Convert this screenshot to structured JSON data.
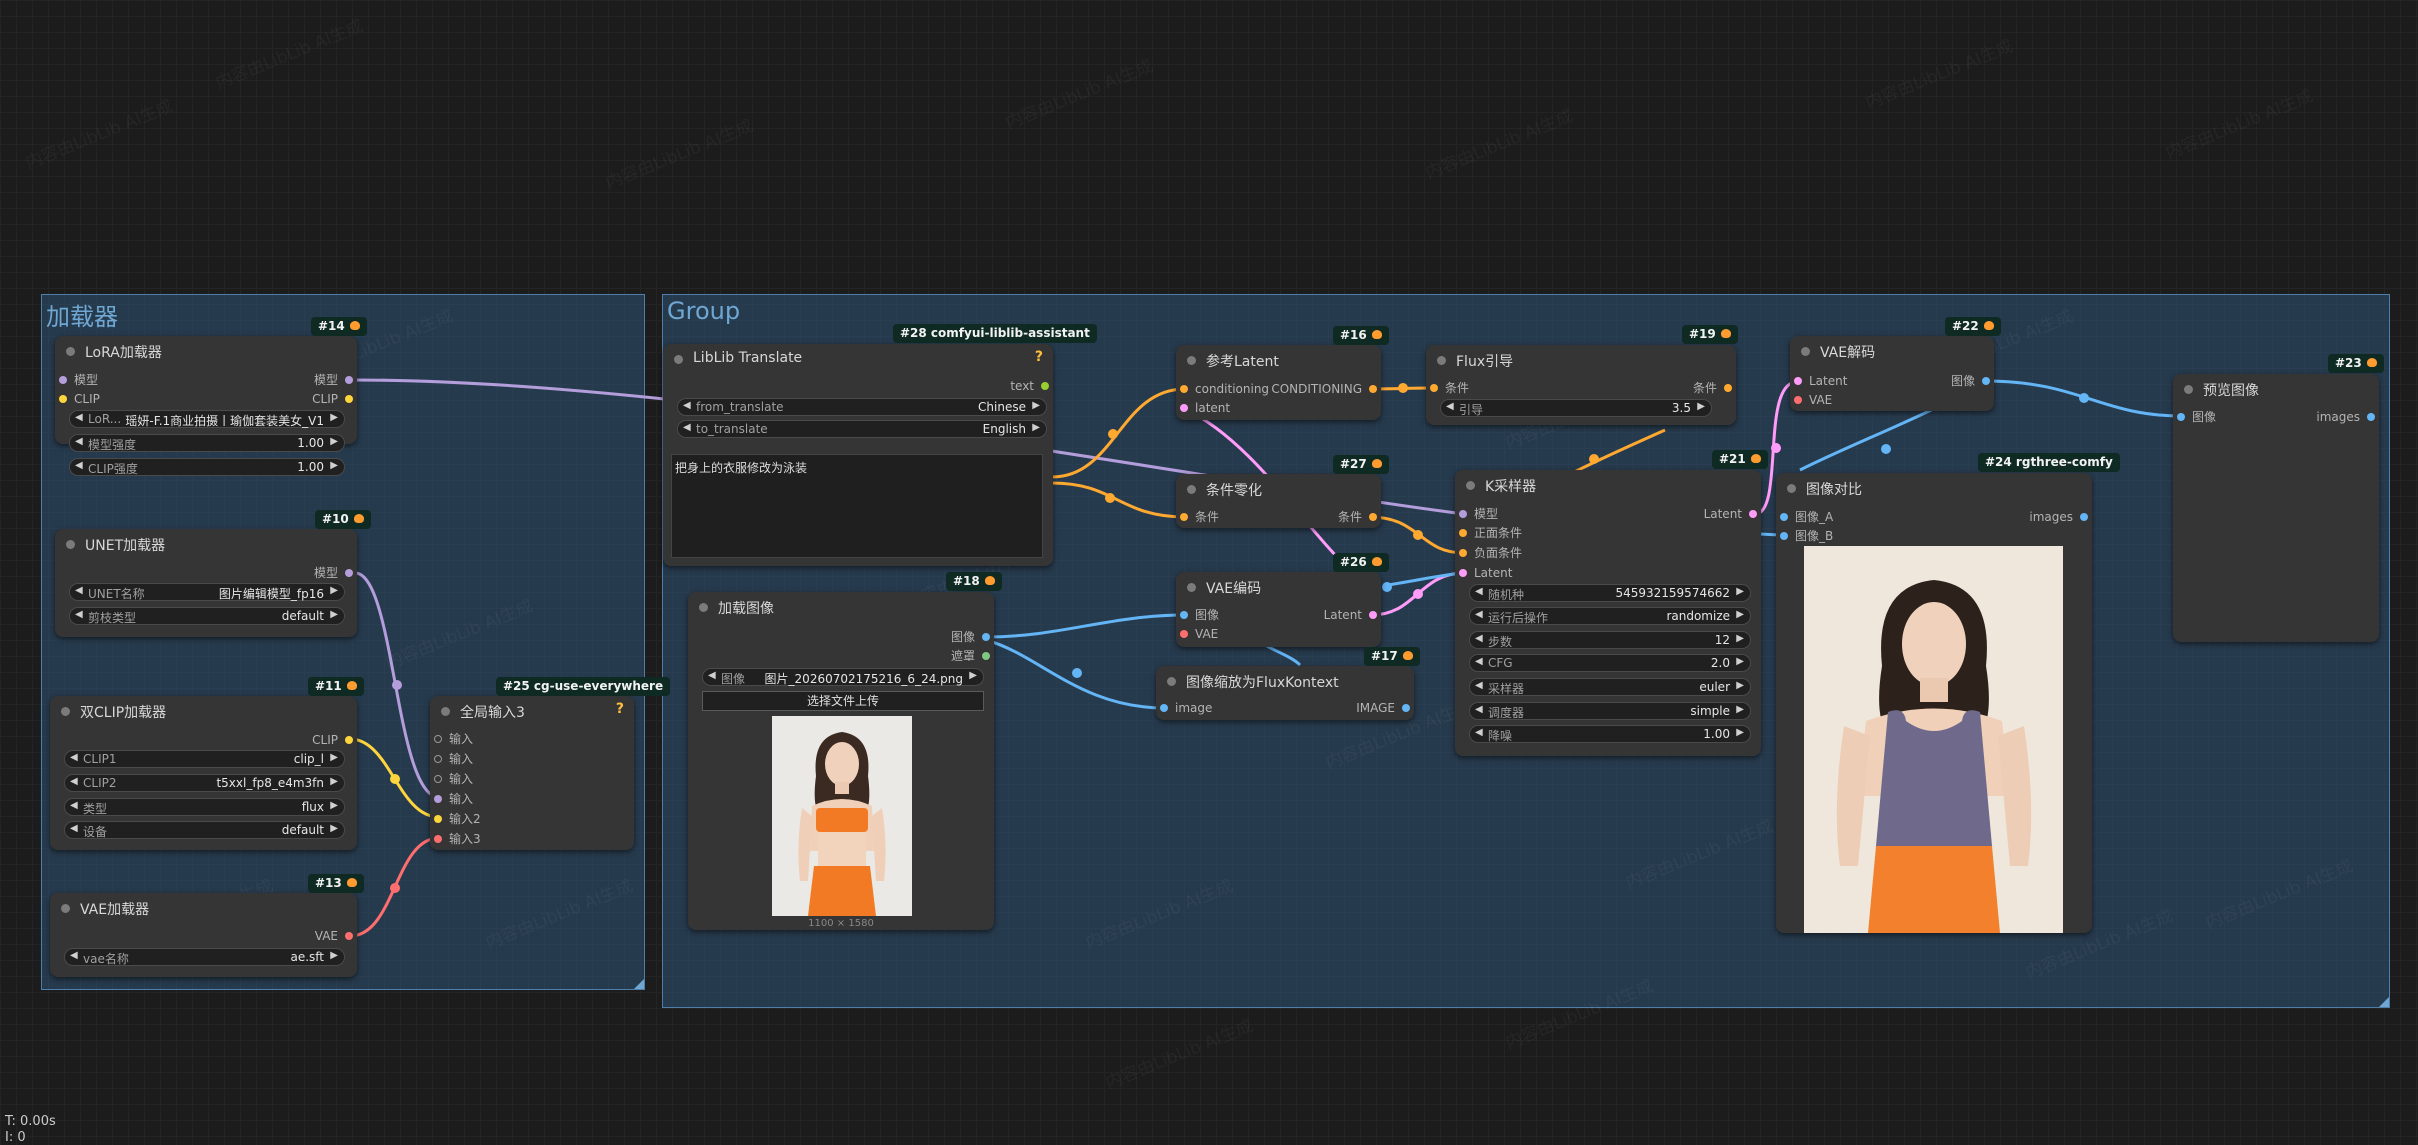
{
  "groups": {
    "loader": "加载器",
    "main": "Group"
  },
  "watermark": "内容由LibLib AI生成",
  "status": {
    "time": "T: 0.00s",
    "second_line": "I: 0"
  },
  "nodes": {
    "lora": {
      "id": "#14",
      "title": "LoRA加载器",
      "inputs": [
        "模型",
        "CLIP"
      ],
      "outputs": [
        "模型",
        "CLIP"
      ],
      "widgets": [
        {
          "label": "LoR...",
          "value": "瑶妍-F.1商业拍摄丨瑜伽套装美女_V1"
        },
        {
          "label": "模型强度",
          "value": "1.00"
        },
        {
          "label": "CLIP强度",
          "value": "1.00"
        }
      ]
    },
    "unet": {
      "id": "#10",
      "title": "UNET加载器",
      "outputs": [
        "模型"
      ],
      "widgets": [
        {
          "label": "UNET名称",
          "value": "图片编辑模型_fp16"
        },
        {
          "label": "剪枝类型",
          "value": "default"
        }
      ]
    },
    "dualclip": {
      "id": "#11",
      "title": "双CLIP加载器",
      "outputs": [
        "CLIP"
      ],
      "widgets": [
        {
          "label": "CLIP1",
          "value": "clip_l"
        },
        {
          "label": "CLIP2",
          "value": "t5xxl_fp8_e4m3fn"
        },
        {
          "label": "类型",
          "value": "flux"
        },
        {
          "label": "设备",
          "value": "default"
        }
      ]
    },
    "vae_loader": {
      "id": "#13",
      "title": "VAE加载器",
      "outputs": [
        "VAE"
      ],
      "widgets": [
        {
          "label": "vae名称",
          "value": "ae.sft"
        }
      ]
    },
    "anything_everywhere": {
      "id": "#25 cg-use-everywhere",
      "title": "全局输入3",
      "help": "?",
      "inputs": [
        "输入",
        "输入",
        "输入",
        "输入",
        "输入2",
        "输入3"
      ]
    },
    "translate": {
      "id": "#28 comfyui-liblib-assistant",
      "title": "LibLib Translate",
      "help": "?",
      "outputs": [
        "text"
      ],
      "widgets": [
        {
          "label": "from_translate",
          "value": "Chinese"
        },
        {
          "label": "to_translate",
          "value": "English"
        }
      ],
      "text": "把身上的衣服修改为泳装"
    },
    "load_image": {
      "id": "#18",
      "title": "加载图像",
      "outputs": [
        "图像",
        "遮罩"
      ],
      "widgets": [
        {
          "label": "图像",
          "value": "图片_20260702175216_6_24.png"
        }
      ],
      "upload_button": "选择文件上传",
      "image_size": "1100 × 1580"
    },
    "ref_latent": {
      "id": "#16",
      "title": "参考Latent",
      "inputs": [
        "conditioning",
        "latent"
      ],
      "outputs": [
        "CONDITIONING"
      ]
    },
    "cond_zero": {
      "id": "#27",
      "title": "条件零化",
      "inputs": [
        "条件"
      ],
      "outputs": [
        "条件"
      ]
    },
    "vae_encode": {
      "id": "#26",
      "title": "VAE编码",
      "inputs": [
        "图像",
        "VAE"
      ],
      "outputs": [
        "Latent"
      ]
    },
    "scale_image": {
      "id": "#17",
      "title": "图像缩放为FluxKontext",
      "inputs": [
        "image"
      ],
      "outputs": [
        "IMAGE"
      ]
    },
    "flux_guidance": {
      "id": "#19",
      "title": "Flux引导",
      "inputs": [
        "条件"
      ],
      "outputs": [
        "条件"
      ],
      "widgets": [
        {
          "label": "引导",
          "value": "3.5"
        }
      ]
    },
    "ksampler": {
      "id": "#21",
      "title": "K采样器",
      "inputs": [
        "模型",
        "正面条件",
        "负面条件",
        "Latent"
      ],
      "outputs": [
        "Latent"
      ],
      "widgets": [
        {
          "label": "随机种",
          "value": "545932159574662"
        },
        {
          "label": "运行后操作",
          "value": "randomize"
        },
        {
          "label": "步数",
          "value": "12"
        },
        {
          "label": "CFG",
          "value": "2.0"
        },
        {
          "label": "采样器",
          "value": "euler"
        },
        {
          "label": "调度器",
          "value": "simple"
        },
        {
          "label": "降噪",
          "value": "1.00"
        }
      ]
    },
    "vae_decode": {
      "id": "#22",
      "title": "VAE解码",
      "inputs": [
        "Latent",
        "VAE"
      ],
      "outputs": [
        "图像"
      ]
    },
    "image_compare": {
      "id": "#24 rgthree-comfy",
      "title": "图像对比",
      "inputs": [
        "图像_A",
        "图像_B"
      ],
      "outputs": [
        "images"
      ]
    },
    "preview": {
      "id": "#23",
      "title": "预览图像",
      "inputs": [
        "图像"
      ],
      "outputs": [
        "images"
      ]
    }
  },
  "colors": {
    "model": "#b39ddb",
    "clip": "#ffd53d",
    "vae": "#ff6e6e",
    "image": "#64b5f6",
    "conditioning": "#ffa931",
    "latent": "#ff9cf9",
    "mask": "#81c784",
    "string": "#9acd32"
  }
}
